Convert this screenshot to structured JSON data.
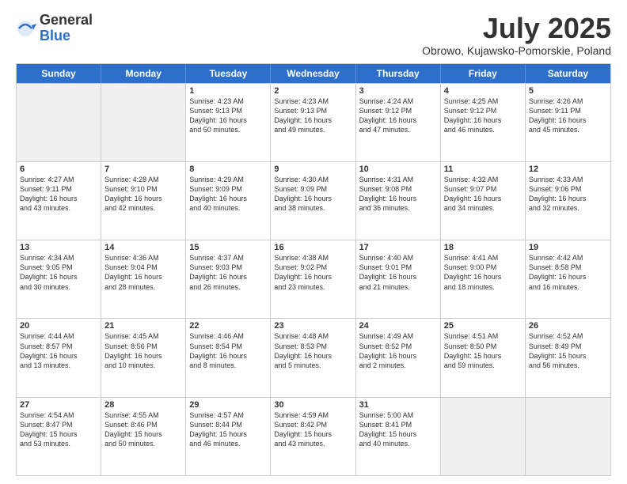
{
  "logo": {
    "general": "General",
    "blue": "Blue"
  },
  "title": "July 2025",
  "subtitle": "Obrowo, Kujawsko-Pomorskie, Poland",
  "header_days": [
    "Sunday",
    "Monday",
    "Tuesday",
    "Wednesday",
    "Thursday",
    "Friday",
    "Saturday"
  ],
  "weeks": [
    [
      {
        "day": "",
        "info": "",
        "shaded": true
      },
      {
        "day": "",
        "info": "",
        "shaded": true
      },
      {
        "day": "1",
        "info": "Sunrise: 4:23 AM\nSunset: 9:13 PM\nDaylight: 16 hours\nand 50 minutes."
      },
      {
        "day": "2",
        "info": "Sunrise: 4:23 AM\nSunset: 9:13 PM\nDaylight: 16 hours\nand 49 minutes."
      },
      {
        "day": "3",
        "info": "Sunrise: 4:24 AM\nSunset: 9:12 PM\nDaylight: 16 hours\nand 47 minutes."
      },
      {
        "day": "4",
        "info": "Sunrise: 4:25 AM\nSunset: 9:12 PM\nDaylight: 16 hours\nand 46 minutes."
      },
      {
        "day": "5",
        "info": "Sunrise: 4:26 AM\nSunset: 9:11 PM\nDaylight: 16 hours\nand 45 minutes."
      }
    ],
    [
      {
        "day": "6",
        "info": "Sunrise: 4:27 AM\nSunset: 9:11 PM\nDaylight: 16 hours\nand 43 minutes."
      },
      {
        "day": "7",
        "info": "Sunrise: 4:28 AM\nSunset: 9:10 PM\nDaylight: 16 hours\nand 42 minutes."
      },
      {
        "day": "8",
        "info": "Sunrise: 4:29 AM\nSunset: 9:09 PM\nDaylight: 16 hours\nand 40 minutes."
      },
      {
        "day": "9",
        "info": "Sunrise: 4:30 AM\nSunset: 9:09 PM\nDaylight: 16 hours\nand 38 minutes."
      },
      {
        "day": "10",
        "info": "Sunrise: 4:31 AM\nSunset: 9:08 PM\nDaylight: 16 hours\nand 36 minutes."
      },
      {
        "day": "11",
        "info": "Sunrise: 4:32 AM\nSunset: 9:07 PM\nDaylight: 16 hours\nand 34 minutes."
      },
      {
        "day": "12",
        "info": "Sunrise: 4:33 AM\nSunset: 9:06 PM\nDaylight: 16 hours\nand 32 minutes."
      }
    ],
    [
      {
        "day": "13",
        "info": "Sunrise: 4:34 AM\nSunset: 9:05 PM\nDaylight: 16 hours\nand 30 minutes."
      },
      {
        "day": "14",
        "info": "Sunrise: 4:36 AM\nSunset: 9:04 PM\nDaylight: 16 hours\nand 28 minutes."
      },
      {
        "day": "15",
        "info": "Sunrise: 4:37 AM\nSunset: 9:03 PM\nDaylight: 16 hours\nand 26 minutes."
      },
      {
        "day": "16",
        "info": "Sunrise: 4:38 AM\nSunset: 9:02 PM\nDaylight: 16 hours\nand 23 minutes."
      },
      {
        "day": "17",
        "info": "Sunrise: 4:40 AM\nSunset: 9:01 PM\nDaylight: 16 hours\nand 21 minutes."
      },
      {
        "day": "18",
        "info": "Sunrise: 4:41 AM\nSunset: 9:00 PM\nDaylight: 16 hours\nand 18 minutes."
      },
      {
        "day": "19",
        "info": "Sunrise: 4:42 AM\nSunset: 8:58 PM\nDaylight: 16 hours\nand 16 minutes."
      }
    ],
    [
      {
        "day": "20",
        "info": "Sunrise: 4:44 AM\nSunset: 8:57 PM\nDaylight: 16 hours\nand 13 minutes."
      },
      {
        "day": "21",
        "info": "Sunrise: 4:45 AM\nSunset: 8:56 PM\nDaylight: 16 hours\nand 10 minutes."
      },
      {
        "day": "22",
        "info": "Sunrise: 4:46 AM\nSunset: 8:54 PM\nDaylight: 16 hours\nand 8 minutes."
      },
      {
        "day": "23",
        "info": "Sunrise: 4:48 AM\nSunset: 8:53 PM\nDaylight: 16 hours\nand 5 minutes."
      },
      {
        "day": "24",
        "info": "Sunrise: 4:49 AM\nSunset: 8:52 PM\nDaylight: 16 hours\nand 2 minutes."
      },
      {
        "day": "25",
        "info": "Sunrise: 4:51 AM\nSunset: 8:50 PM\nDaylight: 15 hours\nand 59 minutes."
      },
      {
        "day": "26",
        "info": "Sunrise: 4:52 AM\nSunset: 8:49 PM\nDaylight: 15 hours\nand 56 minutes."
      }
    ],
    [
      {
        "day": "27",
        "info": "Sunrise: 4:54 AM\nSunset: 8:47 PM\nDaylight: 15 hours\nand 53 minutes."
      },
      {
        "day": "28",
        "info": "Sunrise: 4:55 AM\nSunset: 8:46 PM\nDaylight: 15 hours\nand 50 minutes."
      },
      {
        "day": "29",
        "info": "Sunrise: 4:57 AM\nSunset: 8:44 PM\nDaylight: 15 hours\nand 46 minutes."
      },
      {
        "day": "30",
        "info": "Sunrise: 4:59 AM\nSunset: 8:42 PM\nDaylight: 15 hours\nand 43 minutes."
      },
      {
        "day": "31",
        "info": "Sunrise: 5:00 AM\nSunset: 8:41 PM\nDaylight: 15 hours\nand 40 minutes."
      },
      {
        "day": "",
        "info": "",
        "shaded": true
      },
      {
        "day": "",
        "info": "",
        "shaded": true
      }
    ]
  ]
}
